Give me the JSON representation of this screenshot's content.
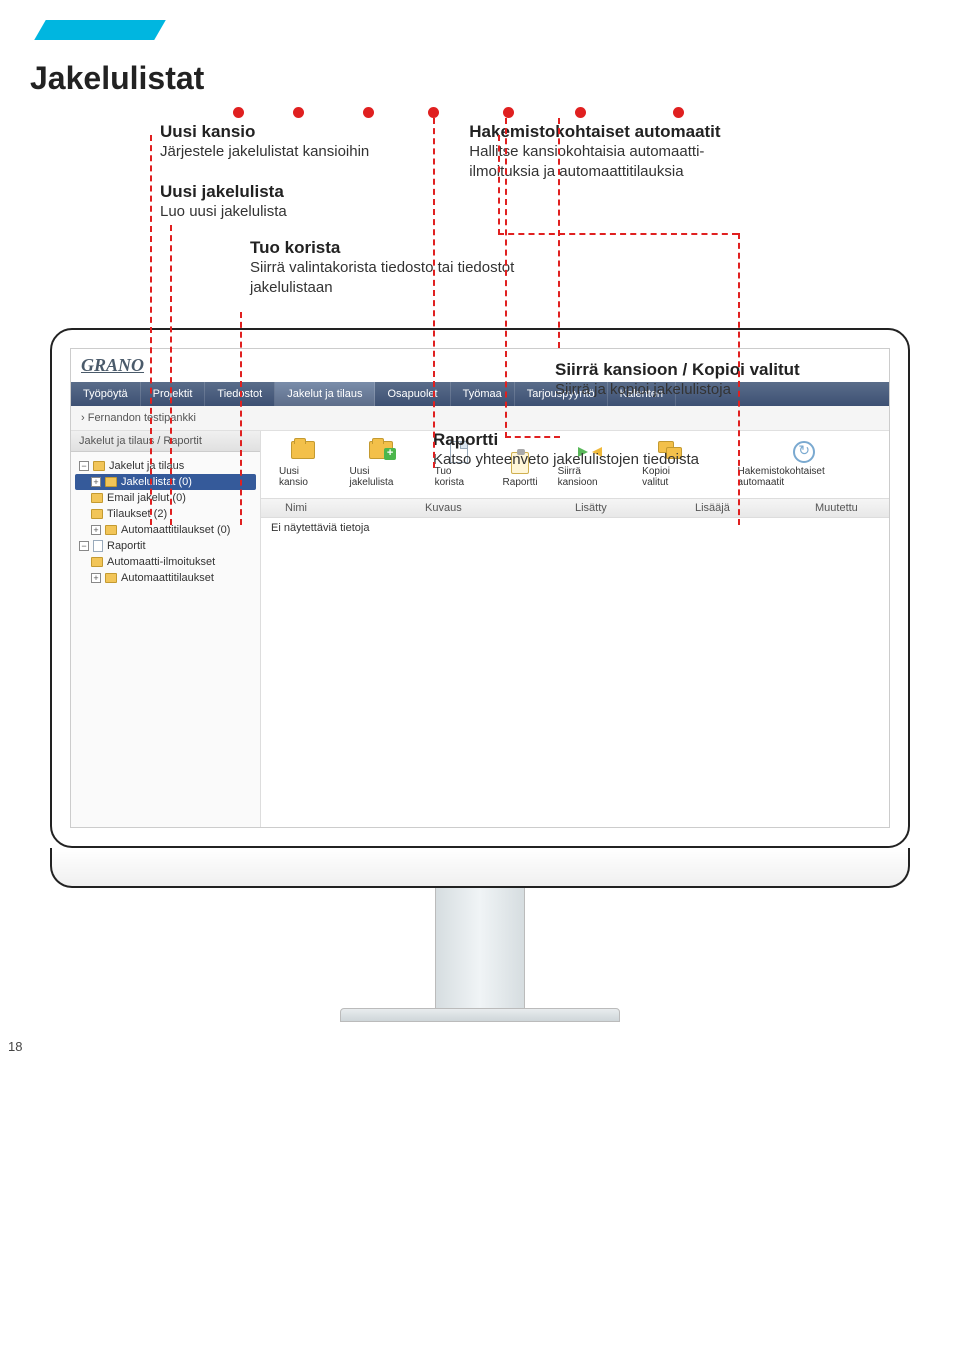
{
  "page": {
    "number": "18",
    "title": "Jakelulistat"
  },
  "callouts": {
    "uusi_kansio": {
      "title": "Uusi kansio",
      "desc": "Järjestele jakelulistat kansioihin"
    },
    "uusi_jakelulista": {
      "title": "Uusi jakelulista",
      "desc": "Luo uusi jakelulista"
    },
    "tuo_korista": {
      "title": "Tuo korista",
      "desc": "Siirrä valintakorista tiedosto tai tiedostot jakelulistaan"
    },
    "hakemisto": {
      "title": "Hakemistokohtaiset automaatit",
      "desc": "Hallitse kansiokohtaisia automaatti-ilmoituksia ja automaattitilauksia"
    },
    "siirra_kopioi": {
      "title": "Siirrä kansioon / Kopioi valitut",
      "desc": "Siirrä ja kopioi jakelulistoja"
    },
    "raportti": {
      "title": "Raportti",
      "desc": "Katso yhteenveto jakelulistojen tiedoista"
    }
  },
  "app": {
    "logo": "GRANO",
    "nav": {
      "tyopoyta": "Työpöytä",
      "projektit": "Projektit",
      "tiedostot": "Tiedostot",
      "jakelut": "Jakelut ja tilaus",
      "osapuolet": "Osapuolet",
      "tyomaa": "Työmaa",
      "tarjouspyynto": "Tarjouspyyntö",
      "kalenteri": "Kalenteri"
    },
    "breadcrumb": "› Fernandon testipankki",
    "sidebar": {
      "header": "Jakelut ja tilaus / Raportit",
      "root": "Jakelut ja tilaus",
      "items": {
        "jakelulistat": "Jakelulistat (0)",
        "email": "Email jakelut (0)",
        "tilaukset": "Tilaukset (2)",
        "automaattitilaukset": "Automaattitilaukset (0)"
      },
      "raportit_root": "Raportit",
      "raportit_items": {
        "ilmoitukset": "Automaatti-ilmoitukset",
        "tilaukset": "Automaattitilaukset"
      }
    },
    "toolbar": {
      "uusi_kansio": "Uusi kansio",
      "uusi_jakelulista": "Uusi jakelulista",
      "tuo_korista": "Tuo korista",
      "raportti": "Raportti",
      "siirra_kansioon": "Siirrä kansioon",
      "kopioi_valitut": "Kopioi valitut",
      "hakemisto": "Hakemistokohtaiset automaatit"
    },
    "table": {
      "headers": {
        "nimi": "Nimi",
        "kuvaus": "Kuvaus",
        "lisatty": "Lisätty",
        "lisaaja": "Lisääjä",
        "muutettu": "Muutettu"
      },
      "empty": "Ei näytettäviä tietoja"
    }
  }
}
